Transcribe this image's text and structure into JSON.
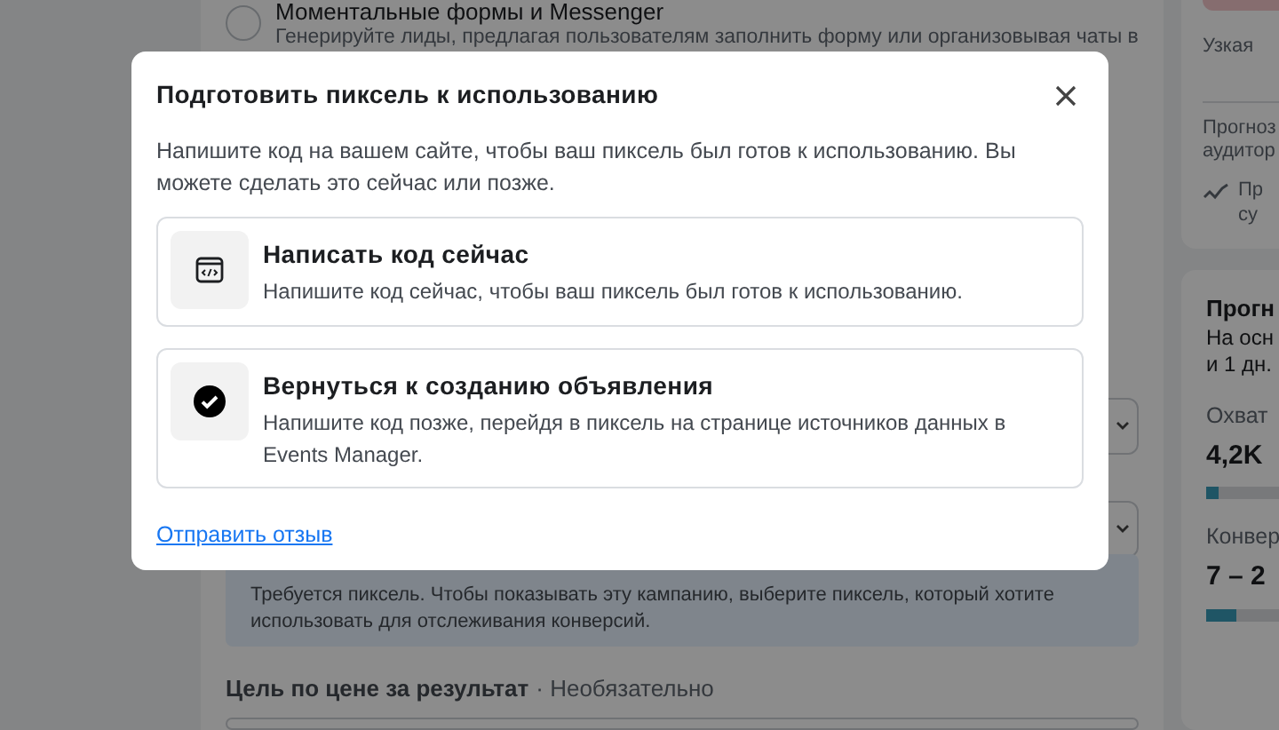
{
  "background": {
    "lead_option": {
      "title": "Моментальные формы и Messenger",
      "description": "Генерируйте лиды, предлагая пользователям заполнить форму или организовывая чаты в",
      "selected": false
    },
    "notice": "Требуется пиксель. Чтобы показывать эту кампанию, выберите пиксель, который хотите использовать для отслеживания конверсий.",
    "cost_goal": {
      "label": "Цель по цене за результат",
      "hint": "· Необязательно"
    },
    "audience": {
      "scale_label": "Узкая",
      "forecast_lines": [
        "Прогноз",
        "аудитор"
      ],
      "tip_lines": [
        "Пр",
        "су"
      ]
    },
    "estimate": {
      "title": "Прогн",
      "lines": [
        "На осн",
        "и 1 дн."
      ],
      "metrics": [
        {
          "label": "Охват",
          "value": "4,2K",
          "level": 0.14
        },
        {
          "label": "Конвер",
          "value": "7 – 2",
          "level": 0.32
        }
      ]
    }
  },
  "dialog": {
    "title": "Подготовить пиксель к использованию",
    "description": "Напишите код на вашем сайте, чтобы ваш пиксель был готов к использованию. Вы можете сделать это сейчас или позже.",
    "options": [
      {
        "kind": "code",
        "title": "Написать код сейчас",
        "description": "Напишите код сейчас, чтобы ваш пиксель был готов к использованию."
      },
      {
        "kind": "check",
        "title": "Вернуться к созданию объявления",
        "description": "Напишите код позже, перейдя в пиксель на странице источников данных в Events Manager."
      }
    ],
    "feedback_link": "Отправить отзыв"
  }
}
